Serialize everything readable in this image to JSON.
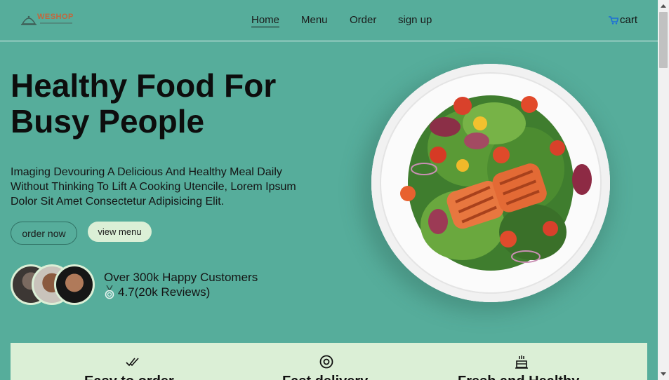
{
  "header": {
    "logo_text": "WESHOP",
    "nav": [
      {
        "label": "Home",
        "active": true
      },
      {
        "label": "Menu",
        "active": false
      },
      {
        "label": "Order",
        "active": false
      },
      {
        "label": "sign up",
        "active": false
      }
    ],
    "cart_label": "cart",
    "cart_icon": "cart-icon"
  },
  "hero": {
    "title_line1": "Healthy Food For",
    "title_line2": "Busy People",
    "description": "Imaging Devouring A Delicious And Healthy Meal Daily Without Thinking To Lift A Cooking Utencile, Lorem Ipsum Dolor Sit Amet Consectetur Adipisicing Elit.",
    "order_button": "order now",
    "menu_button": "view menu",
    "customers_text": "Over 300k Happy Customers",
    "rating_text": "4.7(20k Reviews)",
    "rating_icon": "medal-icon"
  },
  "features": [
    {
      "icon": "double-check-icon",
      "title": "Easy to order"
    },
    {
      "icon": "target-icon",
      "title": "Fast delivery"
    },
    {
      "icon": "cake-icon",
      "title": "Fresh and Healthy"
    }
  ],
  "colors": {
    "background": "#56ad9b",
    "accent_light": "#dbefd6",
    "logo": "#c2673d"
  }
}
